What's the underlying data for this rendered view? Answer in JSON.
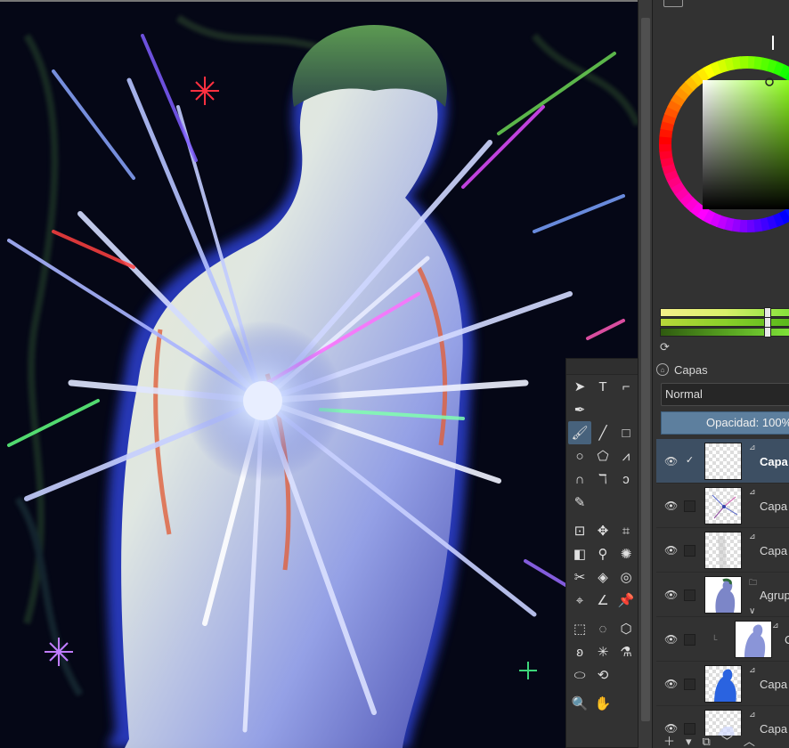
{
  "app": {
    "accent_color": "#5d7f9e",
    "panel_bg": "#323232"
  },
  "toolbox": {
    "rows": [
      [
        {
          "icon": "select-shapes-icon",
          "glyph": "➤"
        },
        {
          "icon": "text-tool-icon",
          "glyph": "T"
        },
        {
          "icon": "edit-shapes-icon",
          "glyph": "⌐"
        }
      ],
      [
        {
          "icon": "calligraphy-pen-icon",
          "glyph": "✒"
        }
      ],
      [
        {
          "icon": "freehand-brush-icon",
          "glyph": "🖌",
          "active": true
        },
        {
          "icon": "line-tool-icon",
          "glyph": "╱"
        },
        {
          "icon": "rectangle-tool-icon",
          "glyph": "□"
        }
      ],
      [
        {
          "icon": "ellipse-tool-icon",
          "glyph": "○"
        },
        {
          "icon": "polygon-tool-icon",
          "glyph": "⬠"
        },
        {
          "icon": "polyline-tool-icon",
          "glyph": "⩘"
        }
      ],
      [
        {
          "icon": "bezier-curve-icon",
          "glyph": "∩"
        },
        {
          "icon": "freehand-path-icon",
          "glyph": "ℸ"
        },
        {
          "icon": "dynamic-brush-icon",
          "glyph": "ↄ"
        }
      ],
      [
        {
          "icon": "multibrush-icon",
          "glyph": "✎"
        }
      ],
      [
        {
          "icon": "transform-tool-icon",
          "glyph": "⊡"
        },
        {
          "icon": "move-tool-icon",
          "glyph": "✥"
        },
        {
          "icon": "crop-tool-icon",
          "glyph": "⌗"
        }
      ],
      [
        {
          "icon": "gradient-tool-icon",
          "glyph": "◧"
        },
        {
          "icon": "color-picker-icon",
          "glyph": "⚲"
        },
        {
          "icon": "smart-patch-icon",
          "glyph": "✺"
        }
      ],
      [
        {
          "icon": "assistant-tool-icon",
          "glyph": "✂"
        },
        {
          "icon": "fill-tool-icon",
          "glyph": "◈"
        },
        {
          "icon": "enclose-fill-icon",
          "glyph": "◎"
        }
      ],
      [
        {
          "icon": "measure-tool-icon",
          "glyph": "⌖"
        },
        {
          "icon": "angle-tool-icon",
          "glyph": "∠"
        },
        {
          "icon": "reference-pin-icon",
          "glyph": "📌"
        }
      ],
      [
        {
          "icon": "rectangular-selection-icon",
          "glyph": "⬚"
        },
        {
          "icon": "elliptical-selection-icon",
          "glyph": "◌"
        },
        {
          "icon": "polygonal-selection-icon",
          "glyph": "⬡"
        }
      ],
      [
        {
          "icon": "freehand-selection-icon",
          "glyph": "ʚ"
        },
        {
          "icon": "magic-wand-icon",
          "glyph": "✳"
        },
        {
          "icon": "color-selection-icon",
          "glyph": "⚗"
        }
      ],
      [
        {
          "icon": "bezier-selection-icon",
          "glyph": "⬭"
        },
        {
          "icon": "magnetic-selection-icon",
          "glyph": "⟲"
        }
      ],
      [
        {
          "icon": "zoom-tool-icon",
          "glyph": "🔍"
        },
        {
          "icon": "pan-tool-icon",
          "glyph": "✋"
        }
      ]
    ]
  },
  "layers": {
    "title": "Capas",
    "blend_mode": "Normal",
    "opacity_label": "Opacidad:  100%",
    "items": [
      {
        "name": "Capa",
        "active": true,
        "checked": true,
        "type": "paint"
      },
      {
        "name": "Capa",
        "active": false,
        "checked": false,
        "type": "paint"
      },
      {
        "name": "Capa",
        "active": false,
        "checked": false,
        "type": "paint"
      },
      {
        "name": "Agrup",
        "active": false,
        "checked": false,
        "type": "group"
      },
      {
        "name": "C",
        "active": false,
        "checked": false,
        "type": "paint",
        "child": true
      },
      {
        "name": "Capa",
        "active": false,
        "checked": false,
        "type": "paint"
      },
      {
        "name": "Capa",
        "active": false,
        "checked": false,
        "type": "paint"
      }
    ]
  },
  "color_selector": {
    "current_color": "#a8d86a",
    "hue_color": "#80ff00"
  }
}
